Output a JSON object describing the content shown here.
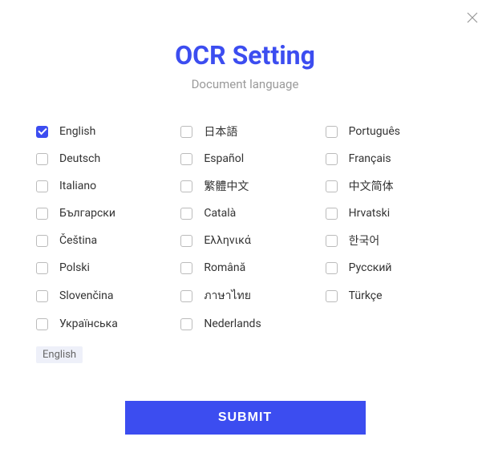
{
  "title": "OCR Setting",
  "subtitle": "Document language",
  "languages": [
    {
      "label": "English",
      "checked": true
    },
    {
      "label": "日本語",
      "checked": false
    },
    {
      "label": "Português",
      "checked": false
    },
    {
      "label": "Deutsch",
      "checked": false
    },
    {
      "label": "Español",
      "checked": false
    },
    {
      "label": "Français",
      "checked": false
    },
    {
      "label": "Italiano",
      "checked": false
    },
    {
      "label": "繁體中文",
      "checked": false
    },
    {
      "label": "中文简体",
      "checked": false
    },
    {
      "label": "Български",
      "checked": false
    },
    {
      "label": "Català",
      "checked": false
    },
    {
      "label": "Hrvatski",
      "checked": false
    },
    {
      "label": "Čeština",
      "checked": false
    },
    {
      "label": "Ελληνικά",
      "checked": false
    },
    {
      "label": "한국어",
      "checked": false
    },
    {
      "label": "Polski",
      "checked": false
    },
    {
      "label": "Română",
      "checked": false
    },
    {
      "label": "Русский",
      "checked": false
    },
    {
      "label": "Slovenčina",
      "checked": false
    },
    {
      "label": "ภาษาไทย",
      "checked": false
    },
    {
      "label": "Türkçe",
      "checked": false
    },
    {
      "label": "Українська",
      "checked": false
    },
    {
      "label": "Nederlands",
      "checked": false
    }
  ],
  "selected_tag": "English",
  "submit_label": "SUBMIT"
}
